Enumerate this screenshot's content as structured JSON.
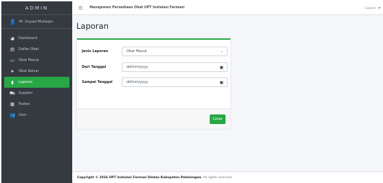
{
  "sidebar": {
    "brand": "ADMIN",
    "user_name": "M. Irsyad Mutaqin",
    "items": [
      {
        "label": "Dashboard",
        "icon": "tachometer-icon",
        "active": false
      },
      {
        "label": "Daftar Obat",
        "icon": "list-icon",
        "active": false
      },
      {
        "label": "Obat Masuk",
        "icon": "inbox-icon",
        "active": false
      },
      {
        "label": "Obat Keluar",
        "icon": "send-icon",
        "active": false
      },
      {
        "label": "Laporan",
        "icon": "file-icon",
        "active": true
      },
      {
        "label": "Supplier",
        "icon": "truck-icon",
        "active": false
      },
      {
        "label": "Faskes",
        "icon": "hospital-icon",
        "active": false
      },
      {
        "label": "User",
        "icon": "users-icon",
        "active": false
      }
    ]
  },
  "header": {
    "title": "Manajemen Persediaan Obat UPT Instalasi Farmasi",
    "logout_label": "Logout"
  },
  "page": {
    "title": "Laporan"
  },
  "form": {
    "jenis_label": "Jenis Laporan",
    "jenis_value": "Obat Masuk",
    "dari_label": "Dari Tanggal",
    "dari_placeholder": "dd/mm/yyyy",
    "sampai_label": "Sampai Tanggal",
    "sampai_placeholder": "dd/mm/yyyy",
    "submit_label": "Cetak"
  },
  "footer": {
    "copyright": "Copyright © 2026 UPT Instalasi Farmasi Dinkes Kabupaten Pekalongan.",
    "rights": "All rights reserved."
  },
  "colors": {
    "accent": "#28a745",
    "sidebar_bg": "#343a40"
  }
}
